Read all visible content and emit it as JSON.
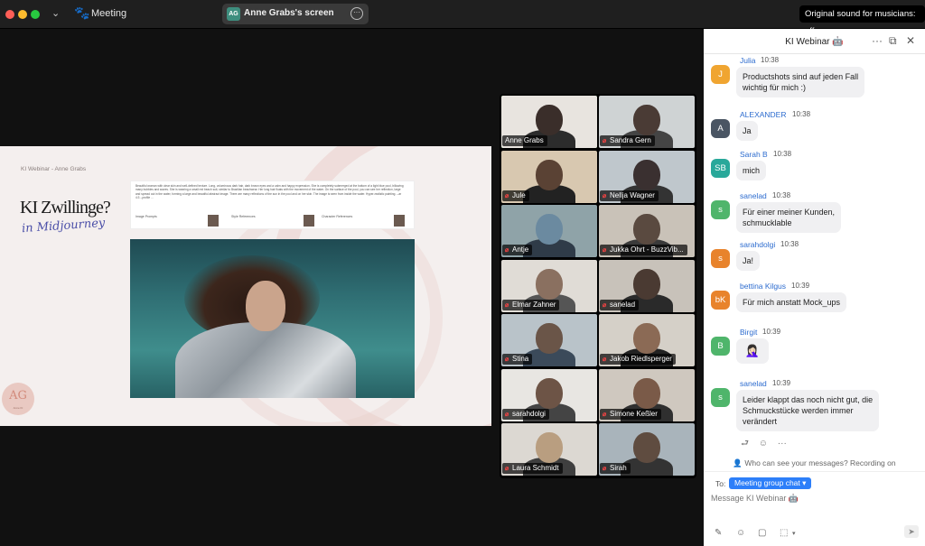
{
  "topbar": {
    "meeting_label": "Meeting",
    "share": {
      "avatar_initials": "AG",
      "label": "Anne Grabs's screen"
    },
    "original_sound": "Original sound for musicians: off"
  },
  "slide": {
    "caption": "KI Webinar - Anne Grabs",
    "title": "KI Zwillinge?",
    "subtitle": "in Midjourney",
    "prompt": "Beautiful woman with clear skin and well-defined texture. Long, voluminous dark hair, dark brown eyes and a calm and happy expression. She is completely submerged at the bottom of a light blue pool, billowing many bubbles and waves. She is wearing a small red beach suit, similar to Brazilian beachwear. Her long hair floats with the movement of the water. On the surface of the pool, you can see her reflection, large and spread out in the water, forming a large and beautiful abstract image. There are many reflections of the sun in the pool and on her skin. The image is seen from inside the water. Hyper-realistic painting. --ar 4:3 --profile ...",
    "prompt_footer": [
      "Image Prompts",
      "Style References",
      "Character References"
    ],
    "logo_text": "AG",
    "logo_sub": "Anne KI"
  },
  "gallery": {
    "tiles": [
      {
        "name": "Anne Grabs",
        "muted": false,
        "active": true
      },
      {
        "name": "Sandra Gern",
        "muted": true,
        "active": false
      },
      {
        "name": "Jule",
        "muted": true,
        "active": false
      },
      {
        "name": "Nellja Wagner",
        "muted": true,
        "active": false
      },
      {
        "name": "Antje",
        "muted": true,
        "active": false
      },
      {
        "name": "Jukka Ohrt - BuzzVib...",
        "muted": true,
        "active": false
      },
      {
        "name": "Elmar Zahner",
        "muted": true,
        "active": false
      },
      {
        "name": "sanelad",
        "muted": true,
        "active": false
      },
      {
        "name": "Stina",
        "muted": true,
        "active": false
      },
      {
        "name": "Jakob Riedlsperger",
        "muted": true,
        "active": false
      },
      {
        "name": "sarahdolgi",
        "muted": true,
        "active": false
      },
      {
        "name": "Simone Keßler",
        "muted": true,
        "active": false
      },
      {
        "name": "Laura Schmidt",
        "muted": true,
        "active": false
      },
      {
        "name": "Sirah",
        "muted": true,
        "active": false
      }
    ]
  },
  "chat": {
    "title": "KI Webinar 🤖",
    "messages": [
      {
        "initials": "J",
        "color": "#f0a531",
        "sender": "Julia",
        "time": "10:38",
        "text_lines": [
          "Productshots sind auf jeden Fall",
          "wichtig für mich :)"
        ]
      },
      {
        "initials": "A",
        "color": "#4a5563",
        "sender": "ALEXANDER",
        "time": "10:38",
        "text_lines": [
          "Ja"
        ]
      },
      {
        "initials": "SB",
        "color": "#29a89a",
        "sender": "Sarah B",
        "time": "10:38",
        "text_lines": [
          "mich"
        ]
      },
      {
        "initials": "s",
        "color": "#4fb56b",
        "sender": "sanelad",
        "time": "10:38",
        "text_lines": [
          "Für einer meiner Kunden,",
          "schmucklable"
        ]
      },
      {
        "initials": "s",
        "color": "#e8832c",
        "sender": "sarahdolgi",
        "time": "10:38",
        "text_lines": [
          "Ja!"
        ]
      },
      {
        "initials": "bK",
        "color": "#e8832c",
        "sender": "bettina Kilgus",
        "time": "10:39",
        "text_lines": [
          "Für mich anstatt Mock_ups"
        ]
      },
      {
        "initials": "B",
        "color": "#4fb56b",
        "sender": "Birgit",
        "time": "10:39",
        "emoji": "🤦🏻‍♀️"
      },
      {
        "initials": "s",
        "color": "#4fb56b",
        "sender": "sanelad",
        "time": "10:39",
        "text_lines": [
          "Leider klappt das noch nicht gut, die",
          "Schmuckstücke werden immer",
          "verändert"
        ]
      }
    ],
    "privacy_note": "Who can see your messages? Recording on",
    "to_label": "To:",
    "recipient": "Meeting group chat ▾",
    "input_placeholder": "Message KI Webinar 🤖"
  }
}
